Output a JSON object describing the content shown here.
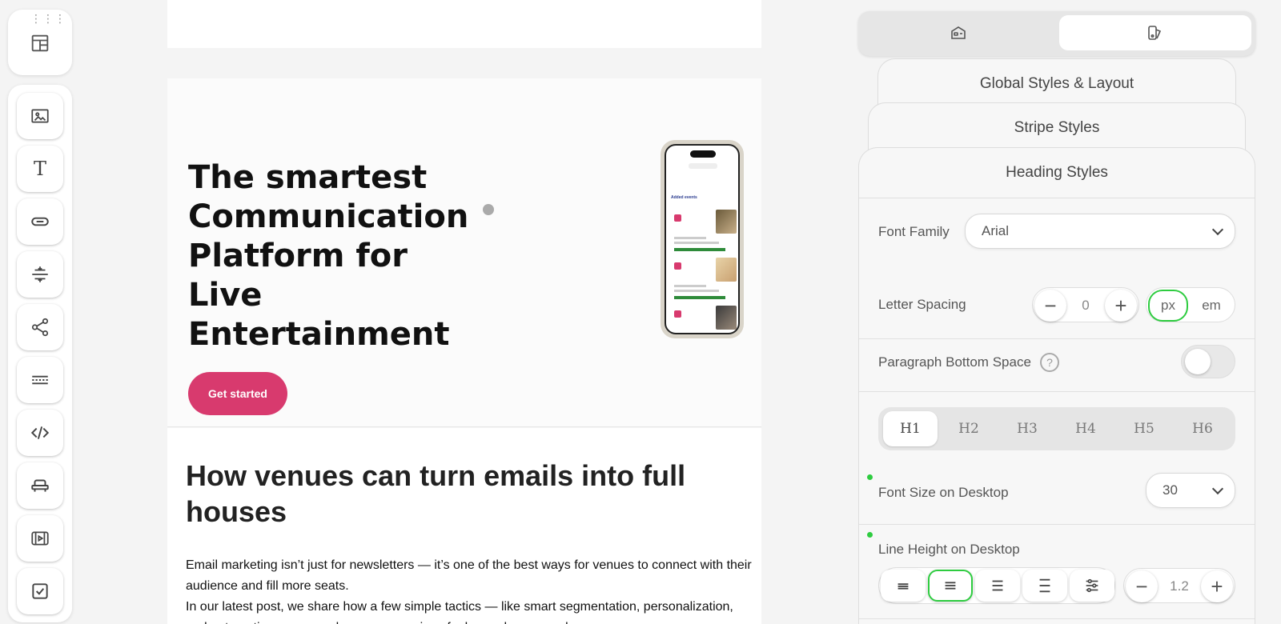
{
  "canvas": {
    "hero": {
      "title": "The smartest Communication Platform for Live Entertainment",
      "cta_label": "Get started",
      "phone_header": "Added events"
    },
    "article": {
      "title": "How venues can turn emails into full houses",
      "paragraph1": "Email marketing isn’t just for newsletters — it’s one of the best ways for venues to connect with their audience and fill more seats.",
      "paragraph2": "In our latest post, we share how a few simple tactics — like smart segmentation, personalization, and automation — can make your campaigns feel more human and more"
    }
  },
  "left_toolbar": {
    "tools": [
      "drag-handle",
      "image-icon",
      "text-icon",
      "button-icon",
      "divider-icon",
      "share-icon",
      "stripe-icon",
      "code-icon",
      "seat-icon",
      "video-icon",
      "checkbox-icon"
    ]
  },
  "right_panel": {
    "tabs": [
      "blocks-tab",
      "styles-tab"
    ],
    "accordions": {
      "global": "Global Styles & Layout",
      "stripe": "Stripe Styles",
      "heading": "Heading Styles"
    },
    "font_family": {
      "label": "Font Family",
      "value": "Arial"
    },
    "letter_spacing": {
      "label": "Letter Spacing",
      "value": "0",
      "units": [
        "px",
        "em"
      ],
      "active_unit": "px"
    },
    "paragraph_bottom_space": {
      "label": "Paragraph Bottom Space",
      "help": "?",
      "enabled": false
    },
    "heading_levels": [
      "H1",
      "H2",
      "H3",
      "H4",
      "H5",
      "H6"
    ],
    "active_heading": "H1",
    "font_size": {
      "label": "Font Size on Desktop",
      "value": "30"
    },
    "line_height": {
      "label": "Line Height on Desktop",
      "value": "1.2"
    },
    "accent_color": "#2ecc40",
    "brand_color": "#d83a6e"
  }
}
